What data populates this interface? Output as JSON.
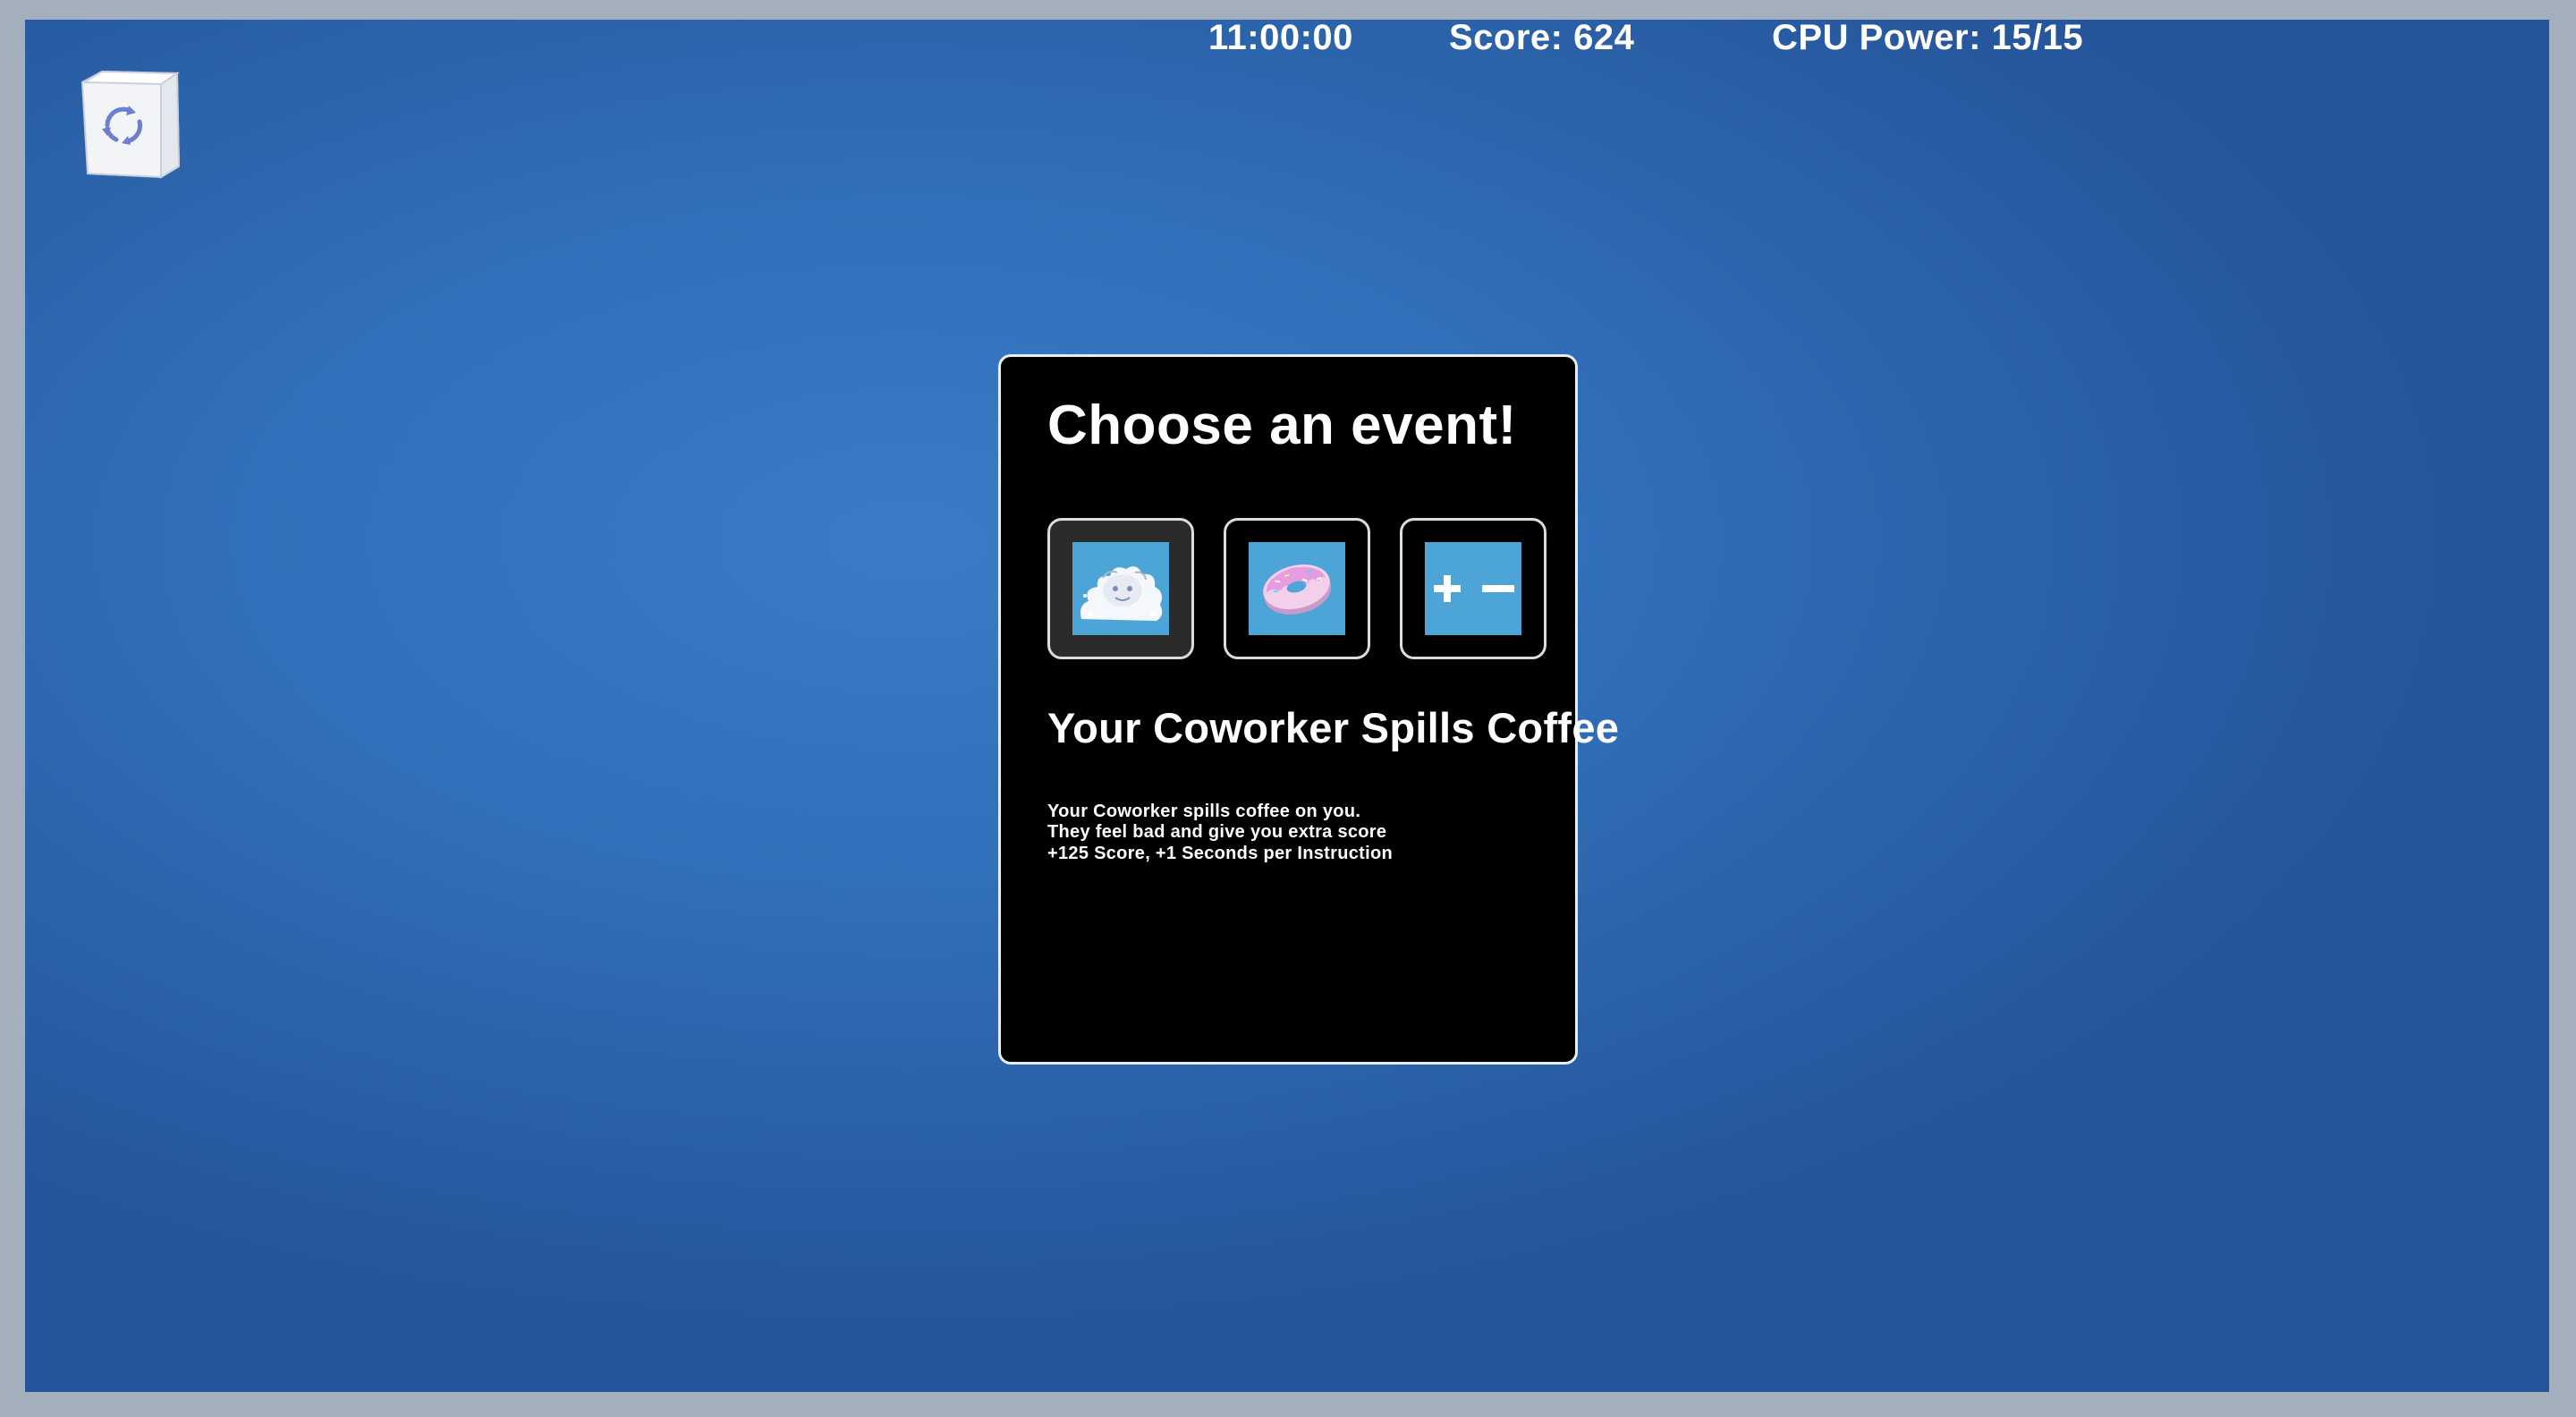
{
  "hud": {
    "time": "11:00:00",
    "score": "Score: 624",
    "cpu_power": "CPU Power: 15/15"
  },
  "desktop": {
    "recycle_bin_icon": "recycle-bin-icon"
  },
  "event_panel": {
    "title": "Choose an event!",
    "options": [
      {
        "icon": "coffee-spill-icon",
        "selected": true
      },
      {
        "icon": "donut-icon",
        "selected": false
      },
      {
        "icon": "plus-minus-icon",
        "selected": false
      }
    ],
    "selected_event": {
      "title": "Your Coworker Spills Coffee",
      "description": [
        "Your Coworker spills coffee on you.",
        "They feel bad and give you extra score",
        "+125 Score, +1 Seconds per Instruction"
      ]
    }
  },
  "colors": {
    "desktop_blue": "#3170ba",
    "panel_background": "#000000",
    "option_thumb": "#4ca5d6",
    "text": "#ffffff"
  }
}
